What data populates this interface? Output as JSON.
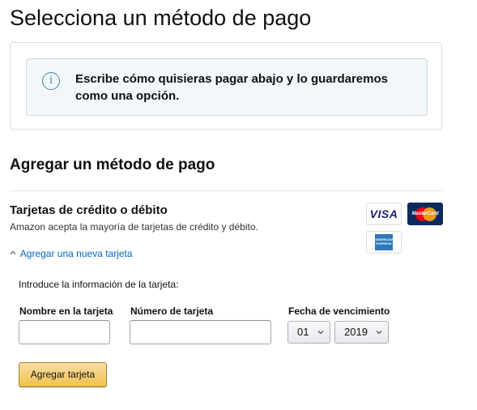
{
  "page": {
    "title": "Selecciona un método de pago"
  },
  "info_box": {
    "icon": "info-icon",
    "icon_glyph": "i",
    "message": "Escribe cómo quisieras pagar abajo y lo guardaremos como una opción."
  },
  "add_method": {
    "title": "Agregar un método de pago"
  },
  "cards": {
    "heading": "Tarjetas de crédito o débito",
    "subtext": "Amazon acepta la mayoría de tarjetas de crédito y débito.",
    "logos": [
      "visa",
      "mastercard",
      "american-express"
    ],
    "visa_text": "VISA",
    "mastercard_text": "MasterCard",
    "amex_text": "AMERICAN EXPRESS",
    "add_link": "Agregar una nueva tarjeta",
    "add_link_icon": "chevron-up-icon"
  },
  "form": {
    "intro": "Introduce la información de la tarjeta:",
    "name_label": "Nombre en la tarjeta",
    "name_value": "",
    "number_label": "Número de tarjeta",
    "number_value": "",
    "expiry_label": "Fecha de vencimiento",
    "month_value": "01",
    "year_value": "2019",
    "submit_label": "Agregar tarjeta"
  },
  "colors": {
    "link": "#0066c0",
    "info_border": "#c9dae3",
    "info_bg": "#f3f7f9",
    "info_icon": "#3d87b3",
    "button_top": "#f7dfa5",
    "button_bottom": "#f0c14b"
  }
}
